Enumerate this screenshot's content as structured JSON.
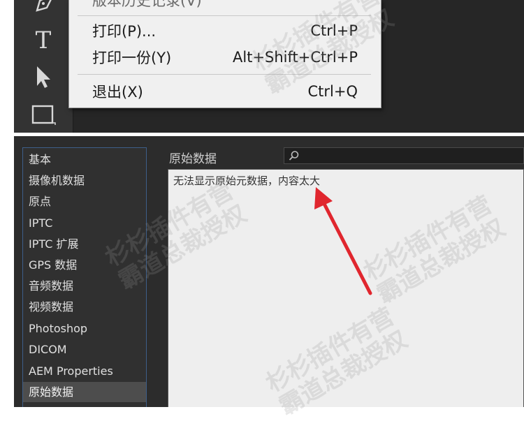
{
  "file_menu": {
    "cut_off_item": "版本历史记录(V)",
    "items": [
      {
        "label": "打印(P)...",
        "shortcut": "Ctrl+P"
      },
      {
        "label": "打印一份(Y)",
        "shortcut": "Alt+Shift+Ctrl+P"
      },
      {
        "label": "退出(X)",
        "shortcut": "Ctrl+Q"
      }
    ]
  },
  "toolbar": {
    "tools": [
      "pen-icon",
      "type-tool-icon",
      "selection-arrow-icon",
      "rectangle-icon"
    ],
    "type_glyph": "T"
  },
  "file_info": {
    "categories": [
      "基本",
      "摄像机数据",
      "原点",
      "IPTC",
      "IPTC 扩展",
      "GPS 数据",
      "音频数据",
      "视频数据",
      "Photoshop",
      "DICOM",
      "AEM Properties",
      "原始数据"
    ],
    "selected_category": "原始数据",
    "section_title": "原始数据",
    "search_placeholder": "",
    "content_message": "无法显示原始元数据，内容太大"
  },
  "annotation_arrow_color": "#e0262e",
  "watermark": {
    "line1": "杉杉插件有营",
    "line2": "霸道总裁授权"
  }
}
